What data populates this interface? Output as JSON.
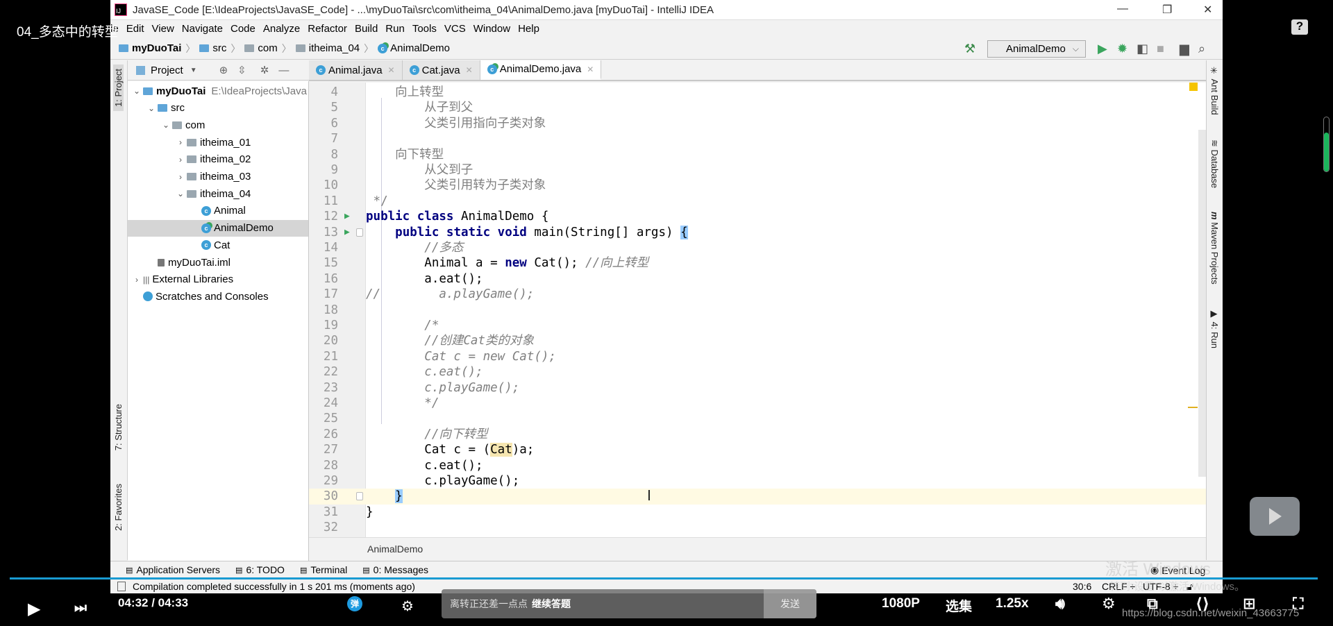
{
  "video": {
    "title": "04_多态中的转型",
    "help_icon": "question-icon",
    "time": "04:32 / 04:33",
    "quality": "1080P",
    "episodes": "选集",
    "speed": "1.25x",
    "danmaku_placeholder": "离转正还差一点点",
    "danmaku_link": "继续答题",
    "send": "发送",
    "progress_percent": 99.6,
    "watermark_csdn": "https://blog.csdn.net/weixin_43663775",
    "win_activate_1": "激活 Windows",
    "win_activate_2": "转到“设置”以激活 Windows。",
    "accent": "#199bd2"
  },
  "window": {
    "title": "JavaSE_Code [E:\\IdeaProjects\\JavaSE_Code] - ...\\myDuoTai\\src\\com\\itheima_04\\AnimalDemo.java [myDuoTai] - IntelliJ IDEA",
    "minimize": "—",
    "maximize": "❐",
    "close": "✕"
  },
  "menu": [
    "le",
    "Edit",
    "View",
    "Navigate",
    "Code",
    "Analyze",
    "Refactor",
    "Build",
    "Run",
    "Tools",
    "VCS",
    "Window",
    "Help"
  ],
  "breadcrumb": [
    "myDuoTai",
    "src",
    "com",
    "itheima_04",
    "AnimalDemo"
  ],
  "run_config": "AnimalDemo",
  "project_panel": {
    "title": "Project",
    "tree": [
      {
        "label": "myDuoTai",
        "extra": "E:\\IdeaProjects\\Java",
        "depth": 0,
        "arrow": "v",
        "icon": "module"
      },
      {
        "label": "src",
        "depth": 1,
        "arrow": "v",
        "icon": "src-folder"
      },
      {
        "label": "com",
        "depth": 2,
        "arrow": "v",
        "icon": "folder"
      },
      {
        "label": "itheima_01",
        "depth": 3,
        "arrow": ">",
        "icon": "folder"
      },
      {
        "label": "itheima_02",
        "depth": 3,
        "arrow": ">",
        "icon": "folder"
      },
      {
        "label": "itheima_03",
        "depth": 3,
        "arrow": ">",
        "icon": "folder"
      },
      {
        "label": "itheima_04",
        "depth": 3,
        "arrow": "v",
        "icon": "folder"
      },
      {
        "label": "Animal",
        "depth": 4,
        "arrow": "",
        "icon": "class"
      },
      {
        "label": "AnimalDemo",
        "depth": 4,
        "arrow": "",
        "icon": "class-run",
        "selected": true
      },
      {
        "label": "Cat",
        "depth": 4,
        "arrow": "",
        "icon": "class"
      },
      {
        "label": "myDuoTai.iml",
        "depth": 1,
        "arrow": "",
        "icon": "iml"
      },
      {
        "label": "External Libraries",
        "depth": 0,
        "arrow": ">",
        "icon": "libraries"
      },
      {
        "label": "Scratches and Consoles",
        "depth": 0,
        "arrow": "",
        "icon": "scratches"
      }
    ]
  },
  "left_stripe": [
    "1: Project",
    "7: Structure",
    "2: Favorites"
  ],
  "right_stripe": [
    "Ant Build",
    "Database",
    "Maven Projects",
    "4: Run"
  ],
  "tabs": [
    {
      "label": "Animal.java",
      "active": false
    },
    {
      "label": "Cat.java",
      "active": false
    },
    {
      "label": "AnimalDemo.java",
      "active": true
    }
  ],
  "editor": {
    "current_line": 30,
    "lines": [
      {
        "n": "4",
        "tokens": [
          {
            "t": "    向上转型",
            "c": "doc"
          }
        ]
      },
      {
        "n": "5",
        "tokens": [
          {
            "t": "        从子到父",
            "c": "doc"
          }
        ]
      },
      {
        "n": "6",
        "tokens": [
          {
            "t": "        父类引用指向子类对象",
            "c": "doc"
          }
        ]
      },
      {
        "n": "7",
        "tokens": []
      },
      {
        "n": "8",
        "tokens": [
          {
            "t": "    向下转型",
            "c": "doc"
          }
        ]
      },
      {
        "n": "9",
        "tokens": [
          {
            "t": "        从父到子",
            "c": "doc"
          }
        ]
      },
      {
        "n": "10",
        "tokens": [
          {
            "t": "        父类引用转为子类对象",
            "c": "doc"
          }
        ]
      },
      {
        "n": "11",
        "tokens": [
          {
            "t": " */",
            "c": "doc"
          }
        ]
      },
      {
        "n": "12",
        "run": true,
        "tokens": [
          {
            "t": "public class",
            "c": "kw"
          },
          {
            "t": " AnimalDemo {",
            "c": ""
          }
        ]
      },
      {
        "n": "13",
        "run": true,
        "fold": true,
        "tokens": [
          {
            "t": "    ",
            "c": ""
          },
          {
            "t": "public static void",
            "c": "kw"
          },
          {
            "t": " main(String[] args) ",
            "c": ""
          },
          {
            "t": "{",
            "c": "br"
          }
        ]
      },
      {
        "n": "14",
        "tokens": [
          {
            "t": "        //多态",
            "c": "cm"
          }
        ]
      },
      {
        "n": "15",
        "tokens": [
          {
            "t": "        Animal a = ",
            "c": ""
          },
          {
            "t": "new",
            "c": "kw"
          },
          {
            "t": " Cat(); ",
            "c": ""
          },
          {
            "t": "//向上转型",
            "c": "cm"
          }
        ]
      },
      {
        "n": "16",
        "tokens": [
          {
            "t": "        a.eat();",
            "c": ""
          }
        ]
      },
      {
        "n": "17",
        "tokens": [
          {
            "t": "//        a.playGame();",
            "c": "cm"
          }
        ]
      },
      {
        "n": "18",
        "tokens": []
      },
      {
        "n": "19",
        "tokens": [
          {
            "t": "        /*",
            "c": "cm"
          }
        ]
      },
      {
        "n": "20",
        "tokens": [
          {
            "t": "        //创建Cat类的对象",
            "c": "cm"
          }
        ]
      },
      {
        "n": "21",
        "tokens": [
          {
            "t": "        Cat c = new Cat();",
            "c": "cm"
          }
        ]
      },
      {
        "n": "22",
        "tokens": [
          {
            "t": "        c.eat();",
            "c": "cm"
          }
        ]
      },
      {
        "n": "23",
        "tokens": [
          {
            "t": "        c.playGame();",
            "c": "cm"
          }
        ]
      },
      {
        "n": "24",
        "tokens": [
          {
            "t": "        */",
            "c": "cm"
          }
        ]
      },
      {
        "n": "25",
        "tokens": []
      },
      {
        "n": "26",
        "tokens": [
          {
            "t": "        //向下转型",
            "c": "cm"
          }
        ]
      },
      {
        "n": "27",
        "tokens": [
          {
            "t": "        Cat c = (",
            "c": ""
          },
          {
            "t": "Cat",
            "c": "hl"
          },
          {
            "t": ")a;",
            "c": ""
          }
        ]
      },
      {
        "n": "28",
        "tokens": [
          {
            "t": "        c.eat();",
            "c": ""
          }
        ]
      },
      {
        "n": "29",
        "tokens": [
          {
            "t": "        c.playGame();",
            "c": ""
          }
        ]
      },
      {
        "n": "30",
        "fold": true,
        "tokens": [
          {
            "t": "    ",
            "c": ""
          },
          {
            "t": "}",
            "c": "br"
          }
        ]
      },
      {
        "n": "31",
        "tokens": [
          {
            "t": "}",
            "c": ""
          }
        ]
      },
      {
        "n": "32",
        "tokens": []
      }
    ],
    "breadcrumb": "AnimalDemo"
  },
  "tool_windows": [
    {
      "label": "Application Servers",
      "icon": "server-icon"
    },
    {
      "label": "6: TODO",
      "icon": "todo-icon"
    },
    {
      "label": "Terminal",
      "icon": "terminal-icon"
    },
    {
      "label": "0: Messages",
      "icon": "messages-icon"
    }
  ],
  "event_log": "Event Log",
  "status": {
    "message": "Compilation completed successfully in 1 s 201 ms (moments ago)",
    "position": "30:6",
    "line_sep": "CRLF ÷",
    "encoding": "UTF-8 ÷"
  }
}
